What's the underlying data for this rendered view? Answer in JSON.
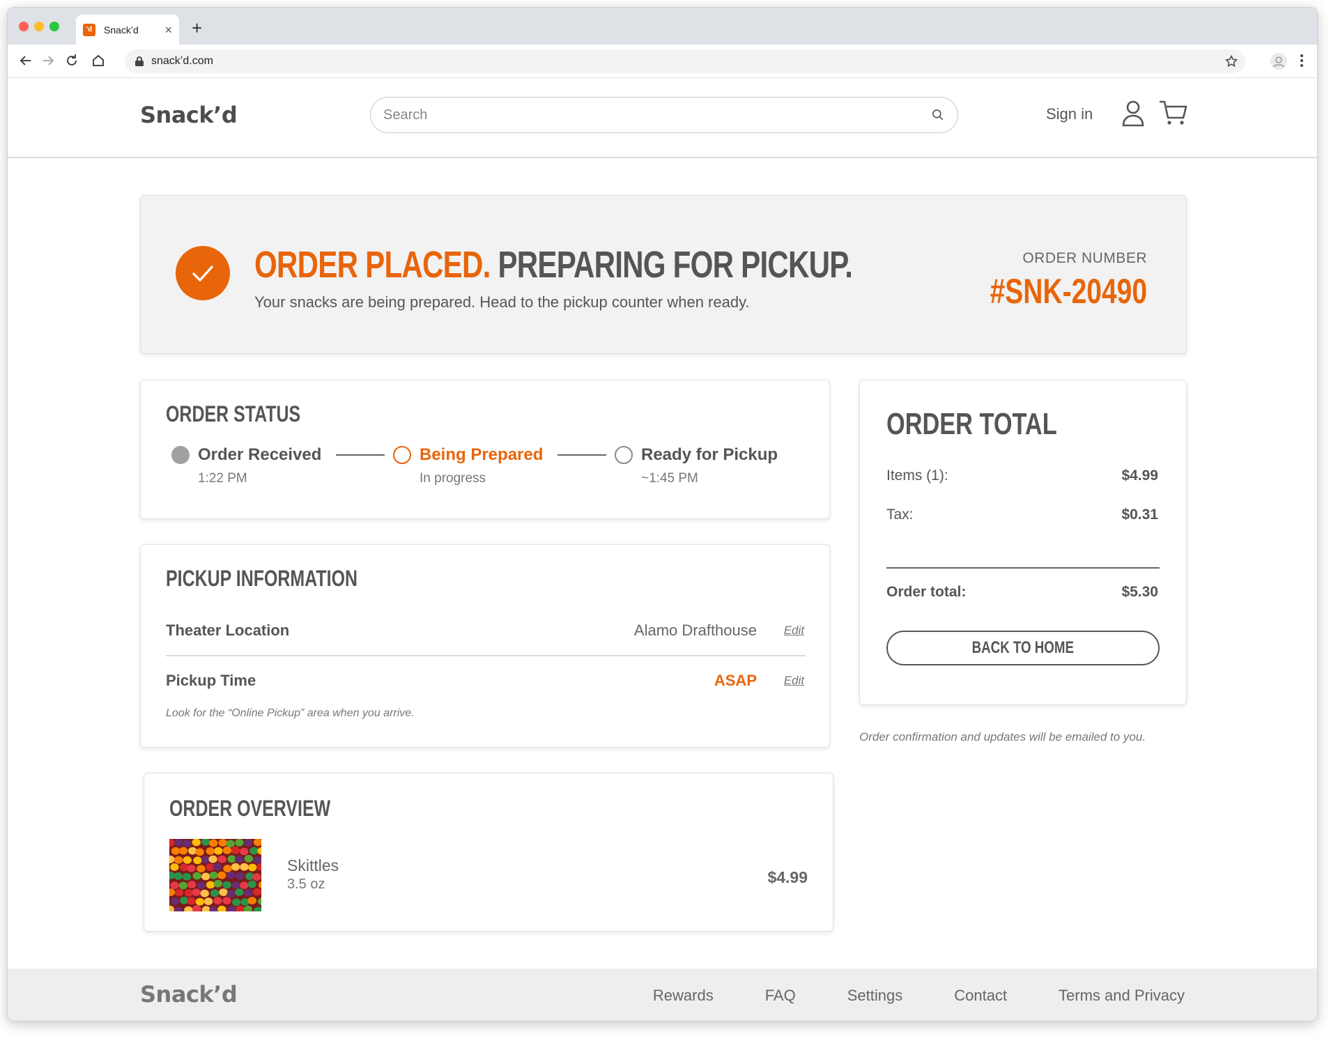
{
  "browser": {
    "tab_title": "Snack’d",
    "favicon_text": "'d",
    "url": "snack’d.com",
    "new_tab_symbol": "+",
    "close_symbol": "×"
  },
  "header": {
    "logo": "Snack’d",
    "search_placeholder": "Search",
    "sign_in": "Sign in"
  },
  "banner": {
    "title_highlight": "ORDER PLACED.",
    "title_rest": "PREPARING FOR PICKUP.",
    "subtitle": "Your snacks are being prepared. Head to the pickup counter when ready.",
    "order_number_label": "ORDER NUMBER",
    "order_number": "#SNK-20490"
  },
  "status": {
    "title": "ORDER STATUS",
    "steps": [
      {
        "label": "Order Received",
        "sub": "1:22 PM",
        "state": "done"
      },
      {
        "label": "Being Prepared",
        "sub": "In progress",
        "state": "active"
      },
      {
        "label": "Ready for Pickup",
        "sub": "~1:45 PM",
        "state": "pending"
      }
    ]
  },
  "pickup": {
    "title": "PICKUP INFORMATION",
    "location_label": "Theater Location",
    "location_value": "Alamo Drafthouse",
    "time_label": "Pickup Time",
    "time_value": "ASAP",
    "edit_label": "Edit",
    "note": "Look for the “Online Pickup” area when you arrive."
  },
  "overview": {
    "title": "ORDER OVERVIEW",
    "items": [
      {
        "name": "Skittles",
        "size": "3.5 oz",
        "price": "$4.99"
      }
    ]
  },
  "total": {
    "title": "ORDER TOTAL",
    "items_label": "Items (1):",
    "items_value": "$4.99",
    "tax_label": "Tax:",
    "tax_value": "$0.31",
    "total_label": "Order total:",
    "total_value": "$5.30",
    "button_label": "BACK TO HOME",
    "email_note": "Order confirmation and updates will be emailed to you."
  },
  "footer": {
    "logo": "Snack’d",
    "links": [
      "Rewards",
      "FAQ",
      "Settings",
      "Contact",
      "Terms and Privacy"
    ]
  },
  "colors": {
    "accent": "#e8650a",
    "text": "#555555",
    "banner_bg": "#f2f2f2",
    "footer_bg": "#eeeeee"
  }
}
